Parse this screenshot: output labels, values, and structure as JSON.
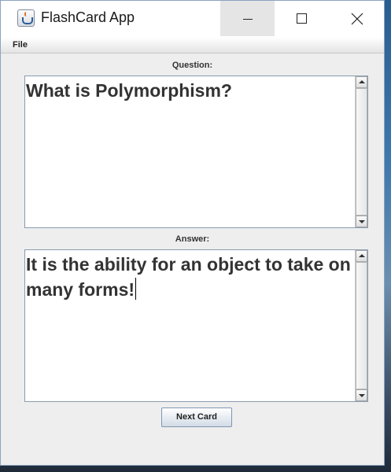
{
  "window": {
    "title": "FlashCard App",
    "icon": "java-coffee-cup-icon"
  },
  "menubar": {
    "file_label": "File"
  },
  "question": {
    "label": "Question:",
    "text": "What is Polymorphism?"
  },
  "answer": {
    "label": "Answer:",
    "text": "It is the ability for an object to take on many forms!"
  },
  "buttons": {
    "next_card": "Next Card"
  }
}
